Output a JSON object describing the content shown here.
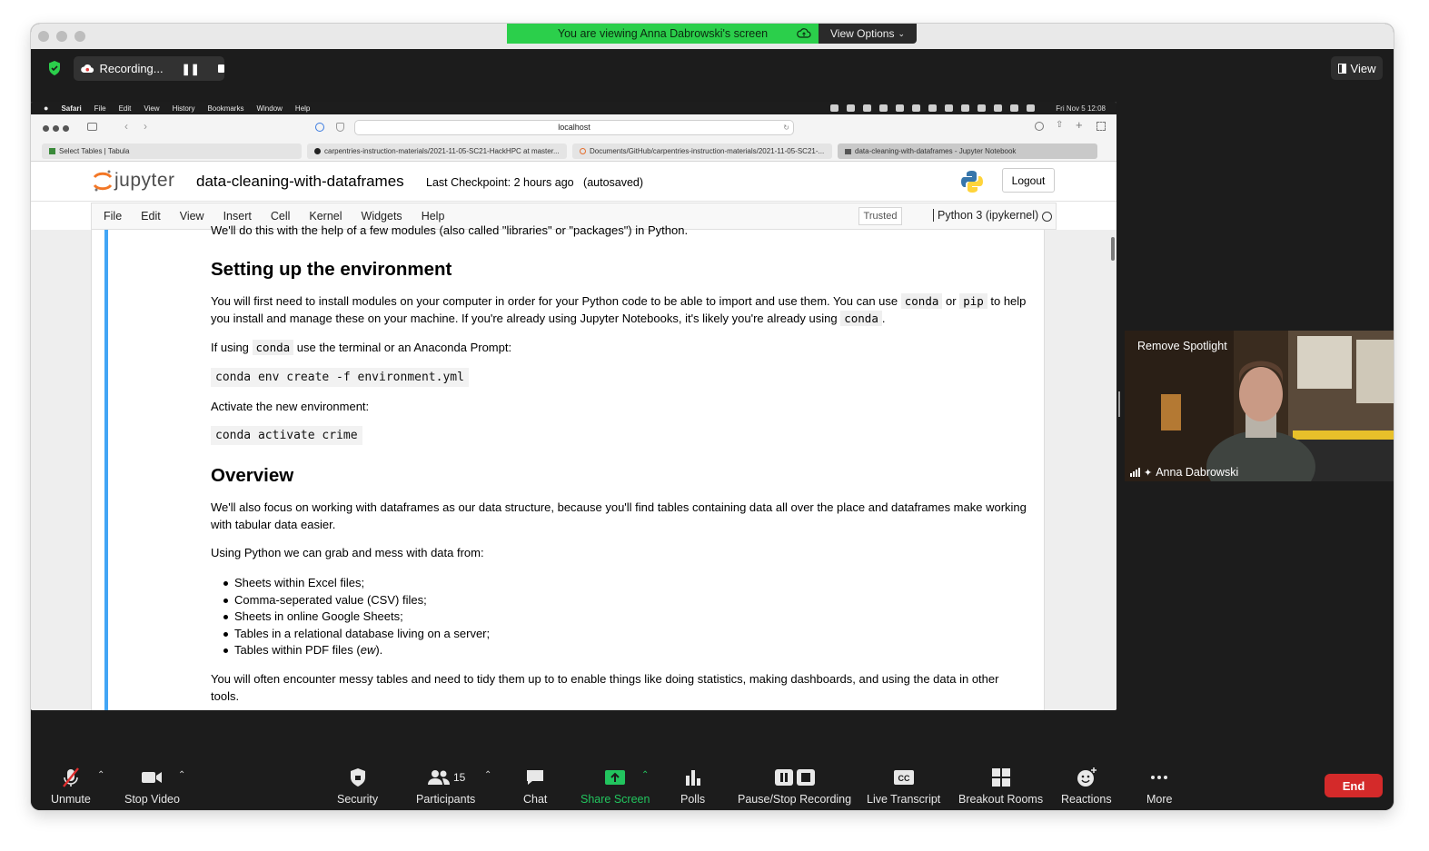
{
  "zoom": {
    "banner": "You are viewing Anna Dabrowski's screen",
    "view_options": "View Options",
    "recording": "Recording...",
    "view_btn": "View",
    "remove_spotlight": "Remove Spotlight",
    "participant_name": "Anna Dabrowski",
    "participants_count": "15",
    "end": "End",
    "toolbar": {
      "unmute": "Unmute",
      "stop_video": "Stop Video",
      "security": "Security",
      "participants": "Participants",
      "chat": "Chat",
      "share_screen": "Share Screen",
      "polls": "Polls",
      "pause_stop_recording": "Pause/Stop Recording",
      "live_transcript": "Live Transcript",
      "breakout_rooms": "Breakout Rooms",
      "reactions": "Reactions",
      "more": "More"
    }
  },
  "mac": {
    "menus": [
      "Safari",
      "File",
      "Edit",
      "View",
      "History",
      "Bookmarks",
      "Window",
      "Help"
    ],
    "clock": "Fri Nov 5  12:08"
  },
  "safari": {
    "url": "localhost",
    "tabs": [
      "Select Tables | Tabula",
      "carpentries-instruction-materials/2021-11-05-SC21-HackHPC at master...",
      "Documents/GitHub/carpentries-instruction-materials/2021-11-05-SC21-...",
      "data-cleaning-with-dataframes - Jupyter Notebook"
    ]
  },
  "jupyter": {
    "logo_text": "jupyter",
    "notebook_title": "data-cleaning-with-dataframes",
    "checkpoint": "Last Checkpoint: 2 hours ago",
    "autosaved": "(autosaved)",
    "logout": "Logout",
    "menu": [
      "File",
      "Edit",
      "View",
      "Insert",
      "Cell",
      "Kernel",
      "Widgets",
      "Help"
    ],
    "trusted": "Trusted",
    "kernel": "Python 3 (ipykernel)"
  },
  "notebook": {
    "top_partial": "We'll do this with the help of a few modules (also called \"libraries\" or \"packages\") in Python.",
    "h_setup": "Setting up the environment",
    "p1_a": "You will first need to install modules on your computer in order for your Python code to be able to import and use them. You can use ",
    "code_conda": "conda",
    "p1_or": " or ",
    "code_pip": "pip",
    "p1_b": " to help you install and manage these on your machine. If you're already using Jupyter Notebooks, it's likely you're already using ",
    "p1_end": ".",
    "p2_a": "If using ",
    "p2_b": " use the terminal or an Anaconda Prompt:",
    "cmd_create": "conda env create -f environment.yml",
    "p3": "Activate the new environment:",
    "cmd_activate": "conda activate crime",
    "h_overview": "Overview",
    "p4": "We'll also focus on working with dataframes as our data structure, because you'll find tables containing data all over the place and dataframes make working with tabular data easier.",
    "p5": "Using Python we can grab and mess with data from:",
    "bullets": [
      "Sheets within Excel files;",
      "Comma-seperated value (CSV) files;",
      "Sheets in online Google Sheets;",
      "Tables in a relational database living on a server;",
      "Tables within PDF files ("
    ],
    "bullet_ew": "ew",
    "bullet_close": ").",
    "p6": "You will often encounter messy tables and need to tidy them up to to enable things like doing statistics, making dashboards, and using the data in other tools."
  },
  "colors": {
    "banner_green": "#2bcf4b",
    "share_green": "#22c45e",
    "end_red": "#d42a2a",
    "cell_blue": "#42a5f5"
  }
}
